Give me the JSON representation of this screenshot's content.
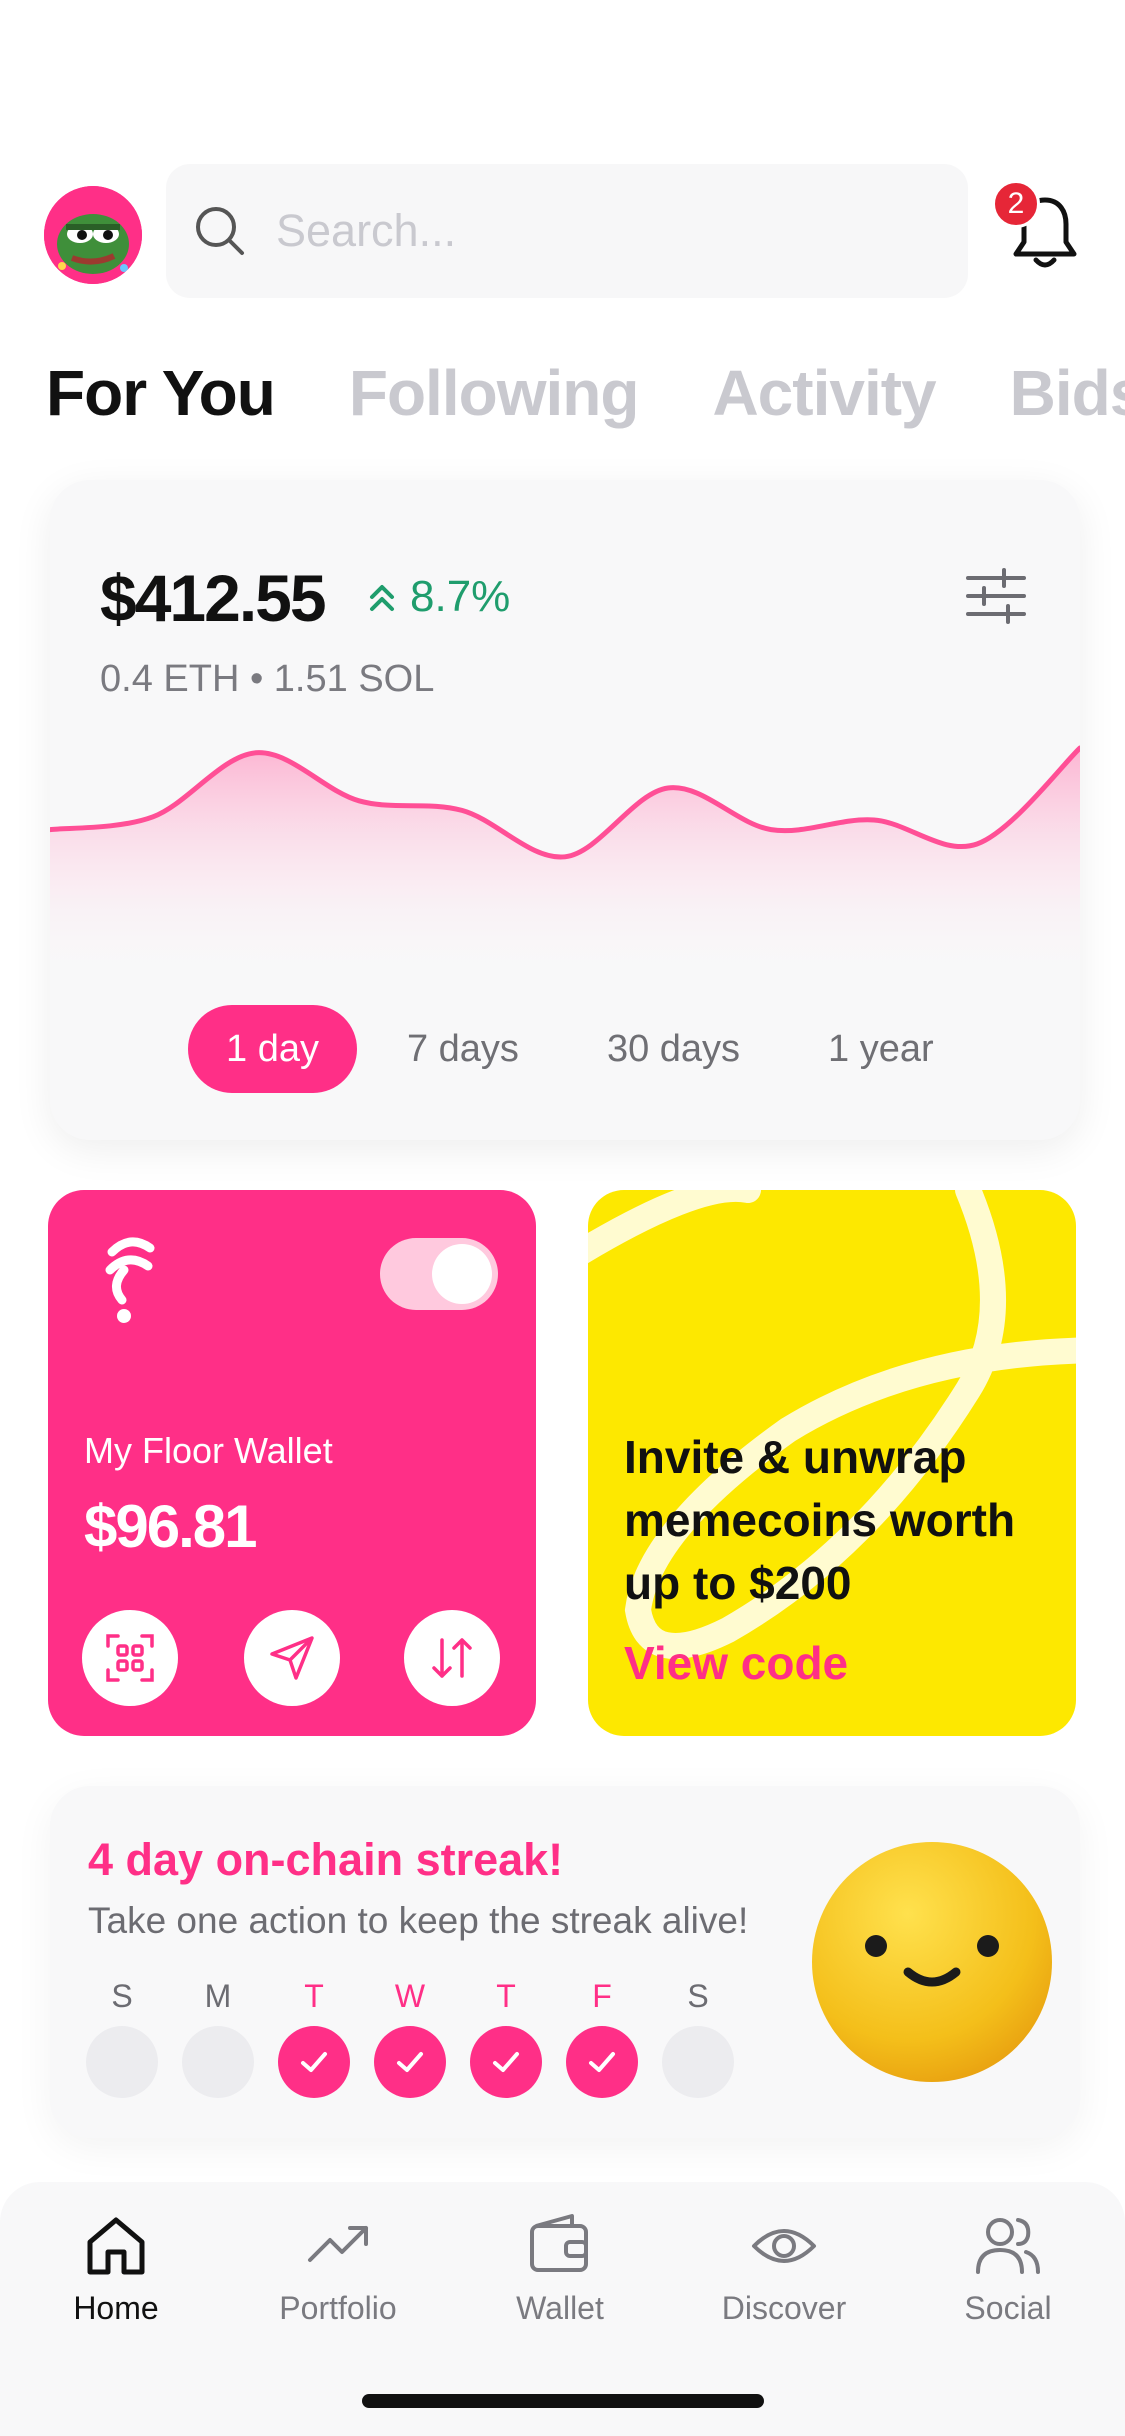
{
  "header": {
    "search_placeholder": "Search...",
    "notification_count": "2"
  },
  "tabs": [
    {
      "label": "For You",
      "active": true
    },
    {
      "label": "Following",
      "active": false
    },
    {
      "label": "Activity",
      "active": false
    },
    {
      "label": "Bids",
      "active": false
    }
  ],
  "balance_card": {
    "balance": "$412.55",
    "change": "8.7%",
    "holdings": "0.4 ETH • 1.51 SOL",
    "ranges": [
      {
        "label": "1 day",
        "active": true
      },
      {
        "label": "7 days",
        "active": false
      },
      {
        "label": "30 days",
        "active": false
      },
      {
        "label": "1 year",
        "active": false
      }
    ]
  },
  "chart_data": {
    "type": "area",
    "title": "",
    "xlabel": "",
    "ylabel": "",
    "grid": false,
    "values": [
      44,
      52,
      92,
      62,
      56,
      27,
      70,
      44,
      50,
      35,
      95
    ]
  },
  "wallet_card": {
    "label": "My Floor Wallet",
    "amount": "$96.81",
    "toggle_on": true
  },
  "invite_card": {
    "text": "Invite & unwrap memecoins worth up to $200",
    "link": "View code"
  },
  "streak_card": {
    "title": "4 day on-chain streak!",
    "subtitle": "Take one action to keep the streak alive!",
    "days": [
      {
        "letter": "S",
        "done": false
      },
      {
        "letter": "M",
        "done": false
      },
      {
        "letter": "T",
        "done": true
      },
      {
        "letter": "W",
        "done": true
      },
      {
        "letter": "T",
        "done": true
      },
      {
        "letter": "F",
        "done": true
      },
      {
        "letter": "S",
        "done": false
      }
    ]
  },
  "bottom_nav": [
    {
      "label": "Home",
      "icon": "home-icon",
      "active": true
    },
    {
      "label": "Portfolio",
      "icon": "trending-up-icon",
      "active": false
    },
    {
      "label": "Wallet",
      "icon": "wallet-icon",
      "active": false
    },
    {
      "label": "Discover",
      "icon": "eye-icon",
      "active": false
    },
    {
      "label": "Social",
      "icon": "users-icon",
      "active": false
    }
  ],
  "colors": {
    "accent": "#ff2f87",
    "positive": "#1f9d6d",
    "yellow": "#fde800"
  }
}
